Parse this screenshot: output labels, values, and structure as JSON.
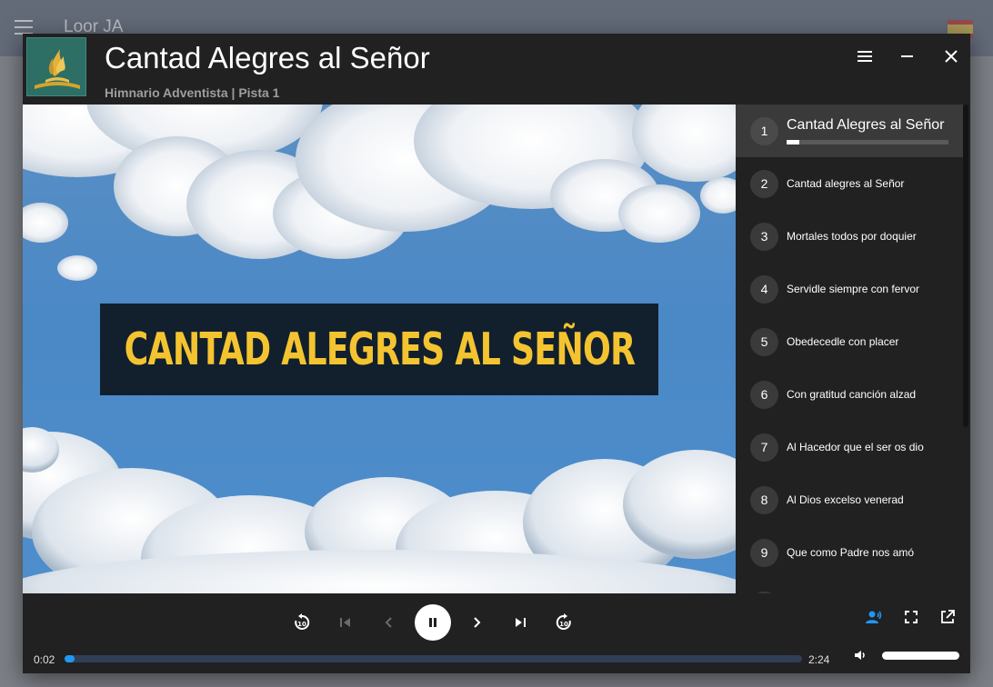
{
  "background_app": {
    "title": "Loor JA"
  },
  "player": {
    "title": "Cantad Alegres al Señor",
    "subtitle": "Himnario Adventista | Pista 1",
    "banner_text": "CANTAD ALEGRES AL SEÑOR",
    "window_buttons": [
      "menu-icon",
      "minimize-icon",
      "close-icon"
    ]
  },
  "playlist": {
    "items": [
      {
        "num": "1",
        "label": "Cantad Alegres al Señor",
        "active": true,
        "progress": 0.08
      },
      {
        "num": "2",
        "label": "Cantad alegres al Señor"
      },
      {
        "num": "3",
        "label": "Mortales todos por doquier"
      },
      {
        "num": "4",
        "label": "Servidle siempre con fervor"
      },
      {
        "num": "5",
        "label": "Obedecedle con placer"
      },
      {
        "num": "6",
        "label": "Con gratitud canción alzad"
      },
      {
        "num": "7",
        "label": "Al Hacedor que el ser os dio"
      },
      {
        "num": "8",
        "label": "Al Dios excelso venerad"
      },
      {
        "num": "9",
        "label": "Que como Padre nos amó"
      }
    ]
  },
  "controls": {
    "current_time": "0:02",
    "duration": "2:24",
    "progress_fraction": 0.014,
    "volume_fraction": 1.0,
    "accent_color": "#2196f3",
    "buttons": [
      "replay-10-icon",
      "skip-previous-icon",
      "chevron-left-icon",
      "pause-icon",
      "chevron-right-icon",
      "skip-next-icon",
      "forward-10-icon"
    ],
    "right_buttons": [
      "voice-icon",
      "fullscreen-icon",
      "open-in-new-icon"
    ],
    "volume_icon": "volume-icon"
  }
}
